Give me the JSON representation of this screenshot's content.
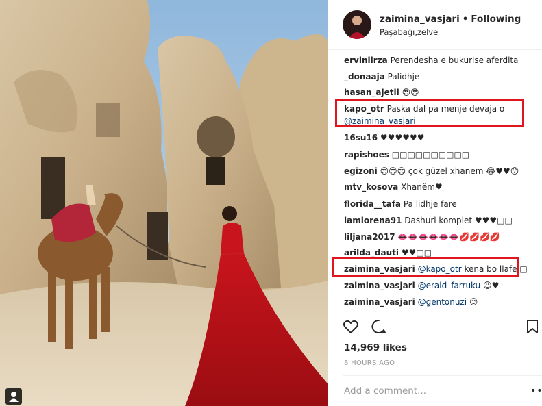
{
  "post": {
    "username": "zaimina_vasjari",
    "separator": "•",
    "follow_status": "Following",
    "location": "Paşabağı,zelve"
  },
  "comments": [
    {
      "user": "ervinlirza",
      "text": "Perendesha e bukurise aferdita"
    },
    {
      "user": "_donaaja",
      "text": "Palidhje"
    },
    {
      "user": "hasan_ajetii",
      "text": "😍😍"
    },
    {
      "user": "kapo_otr",
      "text": "Paska dal pa menje devaja o",
      "mention": "@zaimina_vasjari"
    },
    {
      "user": "16su16",
      "text": "♥♥♥♥♥♥"
    },
    {
      "user": "rapishoes",
      "text": "□□□□□□□□□□"
    },
    {
      "user": "egizoni",
      "text": "😍😍😍 çok güzel xhanem 😂♥♥😯"
    },
    {
      "user": "mtv_kosova",
      "text": "Xhanëm♥"
    },
    {
      "user": "florida__tafa",
      "text": "Pa lidhje fare"
    },
    {
      "user": "iamlorena91",
      "text": "Dashuri komplet ♥♥♥□□"
    },
    {
      "user": "liljana2017",
      "text": "👄👄👄👄👄👄💋💋💋💋"
    },
    {
      "user": "arilda_dauti",
      "text": "♥♥□□"
    },
    {
      "user": "zaimina_vasjari",
      "mention": "@kapo_otr",
      "text": "kena bo llafe □"
    },
    {
      "user": "zaimina_vasjari",
      "mention": "@erald_farruku",
      "text": "😉♥"
    },
    {
      "user": "zaimina_vasjari",
      "mention": "@gentonuzi",
      "text": "😉"
    }
  ],
  "likes": "14,969 likes",
  "time_ago": "8 HOURS AGO",
  "add_comment_placeholder": "Add a comment...",
  "more_options": "•••",
  "icons": {
    "like": "heart-icon",
    "comment": "comment-bubble-icon",
    "save": "bookmark-icon",
    "tag": "person-tag-icon",
    "more": "more-options-icon"
  },
  "colors": {
    "highlight": "#e0161e",
    "mention": "#003569",
    "muted": "#999999"
  }
}
